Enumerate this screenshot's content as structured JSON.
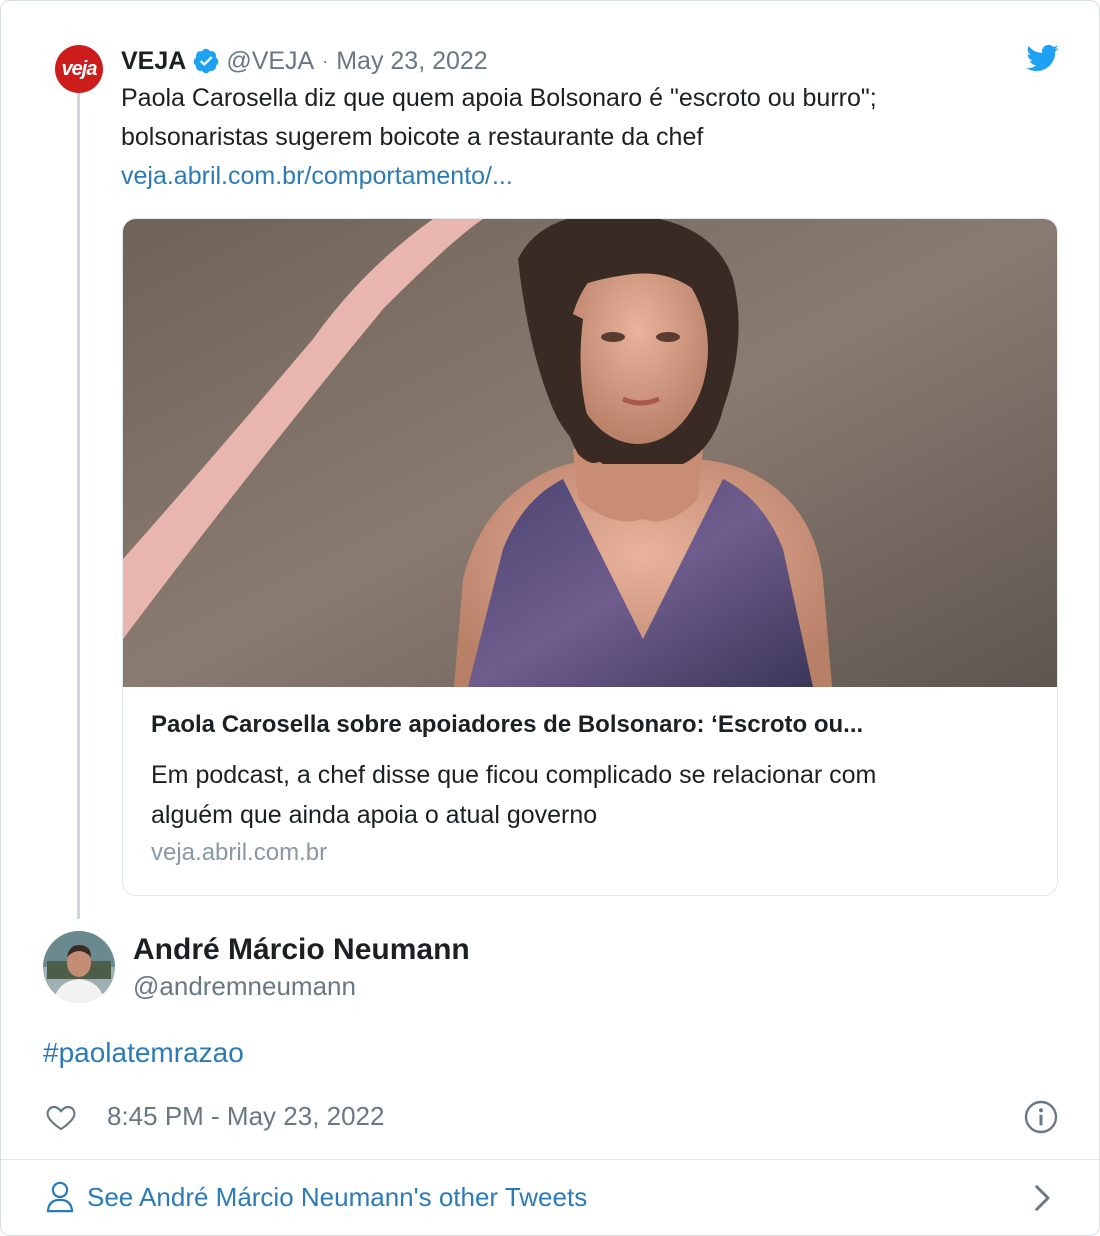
{
  "quoted": {
    "name": "VEJA",
    "handle": "@VEJA",
    "separator": "·",
    "date": "May 23, 2022",
    "logo_text": "veja",
    "text_line1": "Paola Carosella diz que quem apoia Bolsonaro é \"escroto ou burro\";",
    "text_line2": "bolsonaristas sugerem boicote a restaurante da chef",
    "link": "veja.abril.com.br/comportamento/...",
    "card": {
      "title": "Paola Carosella sobre apoiadores de Bolsonaro: ‘Escroto ou...",
      "desc_line1": "Em podcast, a chef disse que ficou complicado se relacionar com",
      "desc_line2": "alguém que ainda apoia o atual governo",
      "domain": "veja.abril.com.br"
    }
  },
  "author": {
    "name": "André Márcio Neumann",
    "handle": "@andremneumann"
  },
  "tweet": {
    "hashtag": "#paolatemrazao",
    "timestamp": "8:45 PM - May 23, 2022"
  },
  "footer": {
    "label": "See André Márcio Neumann's other Tweets"
  },
  "colors": {
    "link": "#2b7bb9",
    "muted": "#697882",
    "verified": "#1da1f2",
    "veja_red": "#cc1c1c"
  },
  "icons": [
    "veja-logo",
    "verified-icon",
    "twitter-bird-icon",
    "heart-icon",
    "info-icon",
    "person-icon",
    "chevron-right-icon"
  ]
}
